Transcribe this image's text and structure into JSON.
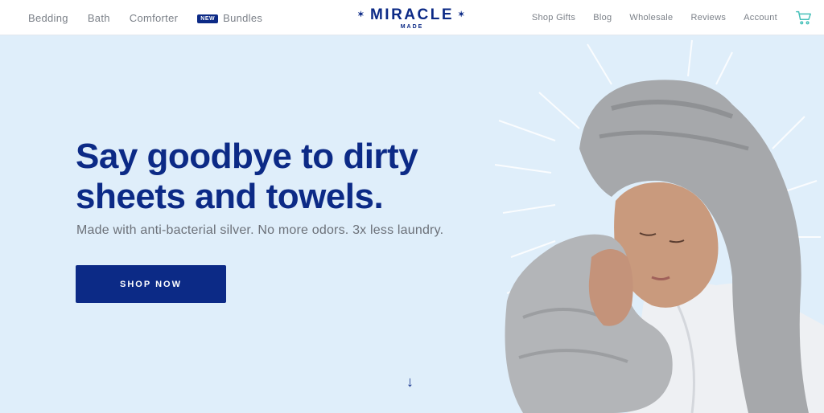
{
  "nav": {
    "left_items": [
      "Bedding",
      "Bath",
      "Comforter"
    ],
    "new_badge": "NEW",
    "bundles_label": "Bundles",
    "right_items": [
      "Shop Gifts",
      "Blog",
      "Wholesale",
      "Reviews",
      "Account"
    ],
    "cart_icon": "cart-icon"
  },
  "logo": {
    "main": "MIRACLE",
    "sub": "MADE",
    "star": "✶"
  },
  "hero": {
    "headline_line1": "Say goodbye to dirty",
    "headline_line2": "sheets and towels.",
    "subline": "Made with anti-bacterial silver. No more odors. 3x less laundry.",
    "cta_label": "SHOP NOW",
    "scroll_icon": "↓"
  },
  "colors": {
    "brand_navy": "#0c2a86",
    "background": "#dfeefa",
    "cart_teal": "#45c0b9"
  }
}
